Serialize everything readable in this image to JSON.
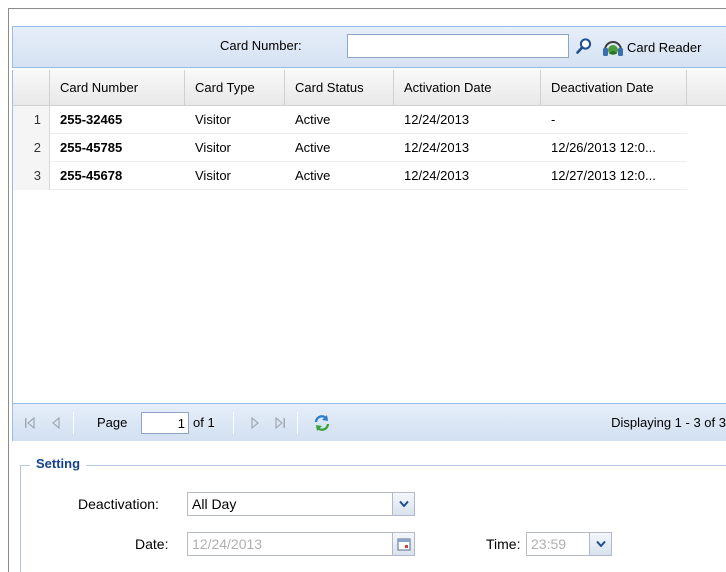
{
  "toolbar": {
    "card_number_label": "Card Number:",
    "card_number_value": "",
    "card_reader_label": "Card Reader"
  },
  "grid": {
    "columns": [
      "Card Number",
      "Card Type",
      "Card Status",
      "Activation Date",
      "Deactivation Date"
    ],
    "rows": [
      {
        "num": "1",
        "card_number": "255-32465",
        "card_type": "Visitor",
        "card_status": "Active",
        "activation": "12/24/2013",
        "deactivation": "-"
      },
      {
        "num": "2",
        "card_number": "255-45785",
        "card_type": "Visitor",
        "card_status": "Active",
        "activation": "12/24/2013",
        "deactivation": "12/26/2013 12:0..."
      },
      {
        "num": "3",
        "card_number": "255-45678",
        "card_type": "Visitor",
        "card_status": "Active",
        "activation": "12/24/2013",
        "deactivation": "12/27/2013 12:0..."
      }
    ]
  },
  "pager": {
    "page_label": "Page",
    "page_value": "1",
    "of_label": "of 1",
    "display_text": "Displaying 1 - 3 of 3"
  },
  "settings": {
    "legend": "Setting",
    "deactivation_label": "Deactivation:",
    "deactivation_value": "All Day",
    "date_label": "Date:",
    "date_value": "12/24/2013",
    "time_label": "Time:",
    "time_value": "23:59"
  },
  "colors": {
    "accent": "#15428b",
    "toolbar_border": "#99bbe8"
  }
}
